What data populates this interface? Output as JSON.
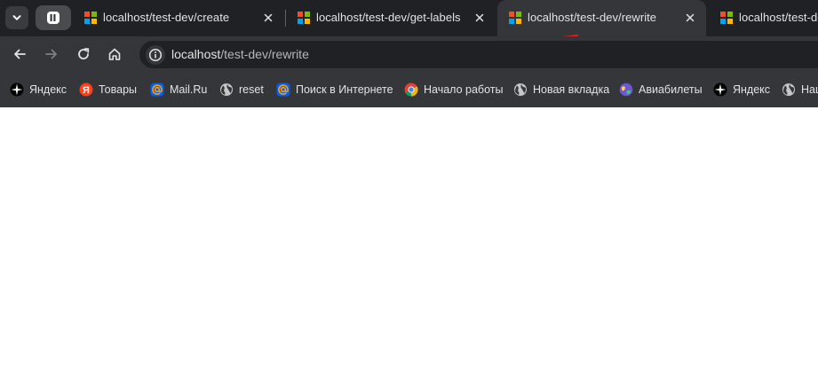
{
  "tabs": [
    {
      "title": "localhost/test-dev/create",
      "active": false
    },
    {
      "title": "localhost/test-dev/get-labels",
      "active": false
    },
    {
      "title": "localhost/test-dev/rewrite",
      "active": true
    },
    {
      "title": "localhost/test-dev",
      "active": false
    }
  ],
  "toolbar": {
    "url_host": "localhost",
    "url_path": "/test-dev/rewrite"
  },
  "bookmarks": [
    {
      "label": "Яндекс",
      "icon": "yandex-star-icon"
    },
    {
      "label": "Товары",
      "icon": "yandex-y-icon"
    },
    {
      "label": "Mail.Ru",
      "icon": "mailru-at-icon"
    },
    {
      "label": "reset",
      "icon": "globe-icon"
    },
    {
      "label": "Поиск в Интернете",
      "icon": "mailru-at-icon"
    },
    {
      "label": "Начало работы",
      "icon": "chrome-icon"
    },
    {
      "label": "Новая вкладка",
      "icon": "globe-icon"
    },
    {
      "label": "Авиабилеты",
      "icon": "planet-icon"
    },
    {
      "label": "Яндекс",
      "icon": "yandex-star-icon"
    },
    {
      "label": "Нац",
      "icon": "globe-icon"
    }
  ],
  "colors": {
    "tabstrip_bg": "#202124",
    "toolbar_bg": "#35363a",
    "omnibox_bg": "#202124",
    "text": "#e3e3e3",
    "red_mark": "#e0201b"
  }
}
